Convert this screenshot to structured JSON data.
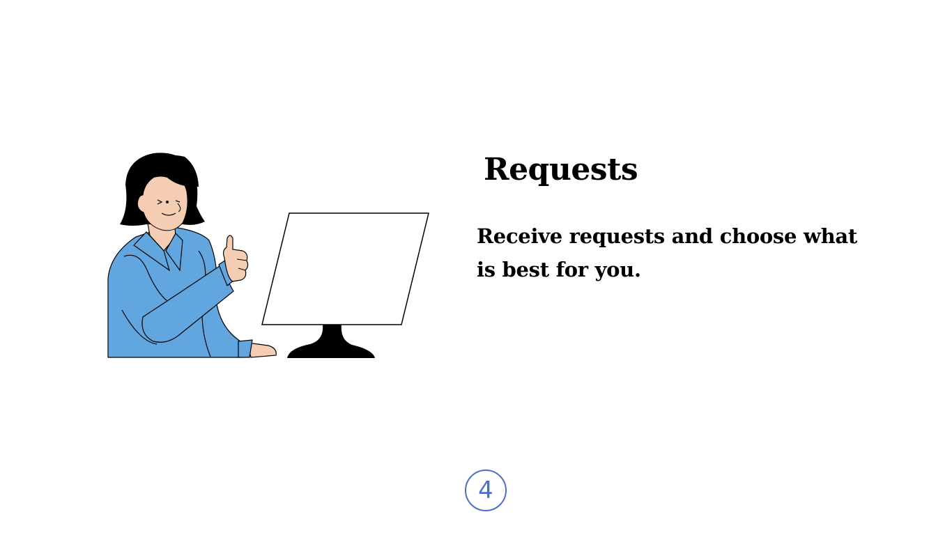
{
  "slide": {
    "title": "Requests",
    "description": "Receive requests and choose what is best for you.",
    "step_number": "4"
  },
  "illustration": {
    "subject": "woman-thumbs-up-at-monitor",
    "shirt_color": "#62a6df",
    "skin_color": "#f5cdb3",
    "hair_color": "#000000",
    "monitor_screen_color": "#ffffff",
    "monitor_stand_color": "#000000"
  },
  "colors": {
    "background": "#ffffff",
    "text": "#000000",
    "accent": "#4a6fc7"
  }
}
